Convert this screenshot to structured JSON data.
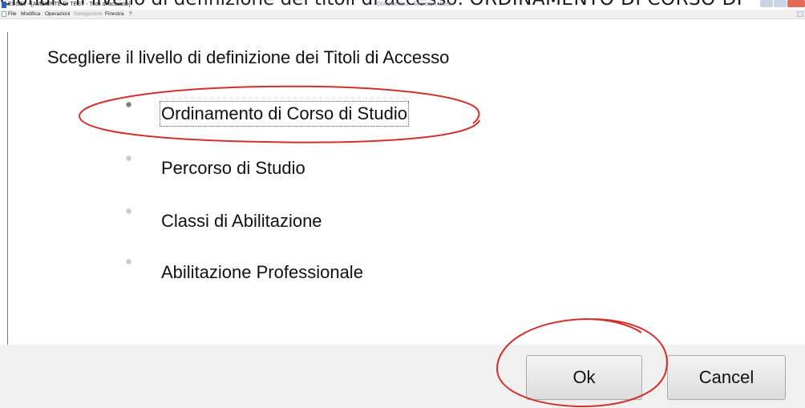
{
  "caption": {
    "lead": "eionare il livello di definizione dei titoli di accesso: ",
    "highlight": "ORDINAMENTO DI CORSO DI"
  },
  "window": {
    "title": "ESSE3 - [AMBIENTE DI TEST - Titoli di accesso]",
    "center_title": "Documento1 - Microsoft Word"
  },
  "menu": {
    "items": [
      "File",
      "Modifica",
      "Operazioni",
      "Navigazione",
      "Finestra",
      "?"
    ],
    "disabled": [
      "Navigazione"
    ]
  },
  "dialog": {
    "heading": "Scegliere il livello di definizione dei Titoli di Accesso",
    "options": [
      {
        "label": "Ordinamento di Corso di Studio",
        "selected": true
      },
      {
        "label": "Percorso di Studio",
        "selected": false
      },
      {
        "label": "Classi di Abilitazione",
        "selected": false
      },
      {
        "label": "Abilitazione Professionale",
        "selected": false
      }
    ],
    "ok_label": "Ok",
    "cancel_label": "Cancel"
  },
  "annotations": {
    "color": "#d0312d",
    "circled": [
      "Ordinamento di Corso di Studio",
      "Ok"
    ]
  }
}
